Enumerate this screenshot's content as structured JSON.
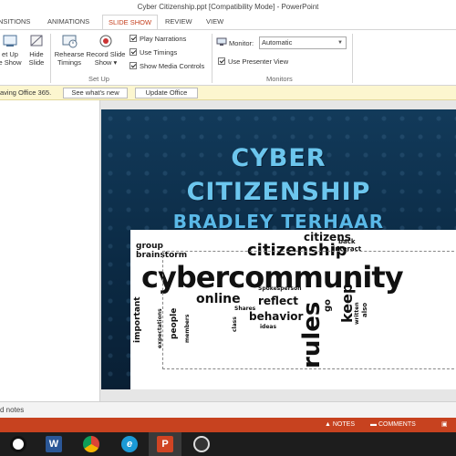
{
  "window": {
    "title": "Cyber Citizenship.ppt [Compatibility Mode] - PowerPoint"
  },
  "ribbon_tabs": [
    {
      "label": "NSITIONS"
    },
    {
      "label": "ANIMATIONS"
    },
    {
      "label": "SLIDE SHOW",
      "active": true
    },
    {
      "label": "REVIEW"
    },
    {
      "label": "VIEW"
    }
  ],
  "ribbon": {
    "setup_show": {
      "line1": "et Up",
      "line2": "e Show"
    },
    "hide_slide": {
      "line1": "Hide",
      "line2": "Slide"
    },
    "rehearse": {
      "line1": "Rehearse",
      "line2": "Timings"
    },
    "record": {
      "line1": "Record Slide",
      "line2": "Show ▾"
    },
    "checkboxes": [
      {
        "label": "Play Narrations",
        "checked": true
      },
      {
        "label": "Use Timings",
        "checked": true
      },
      {
        "label": "Show Media Controls",
        "checked": true
      }
    ],
    "setup_group_label": "Set Up",
    "monitor_label": "Monitor:",
    "monitor_value": "Automatic",
    "presenter_view": {
      "label": "Use Presenter View",
      "checked": true
    },
    "monitors_group_label": "Monitors"
  },
  "message_bar": {
    "text": "aving Office 365.",
    "whats_new": "See what's new",
    "update": "Update Office",
    "color": "#fcf6cf"
  },
  "slide": {
    "title_line1": "CYBER",
    "title_line2": "CITIZENSHIP",
    "author": "BRADLEY TERHAAR",
    "title_color": "#6cc6ee"
  },
  "wordcloud": {
    "words": {
      "cybercommunity": "cybercommunity",
      "citizenship": "citizenship",
      "citizens": "citizens",
      "rules": "rules",
      "good": "good",
      "online": "online",
      "behavior": "behavior",
      "reflect": "reflect",
      "brainstorm": "brainstorm",
      "group": "group",
      "similar": "similar",
      "keep": "keep",
      "important": "important",
      "people": "people",
      "interact": "interact",
      "back": "back",
      "spokesperson": "Spokesperson",
      "shares": "Shares",
      "ideas": "ideas",
      "go": "go",
      "class": "class",
      "members": "members",
      "also": "also",
      "written": "written",
      "expectations": "expectations"
    }
  },
  "notes_bar": {
    "label": "d notes"
  },
  "status_bar": {
    "notes": "NOTES",
    "comments": "COMMENTS",
    "color": "#c7421f"
  },
  "taskbar": {
    "icons": [
      {
        "name": "obs-icon"
      },
      {
        "name": "word-icon",
        "letter": "W"
      },
      {
        "name": "chrome-icon"
      },
      {
        "name": "ie-icon",
        "letter": "e"
      },
      {
        "name": "powerpoint-icon",
        "letter": "P"
      },
      {
        "name": "obs-studio-icon"
      }
    ]
  }
}
